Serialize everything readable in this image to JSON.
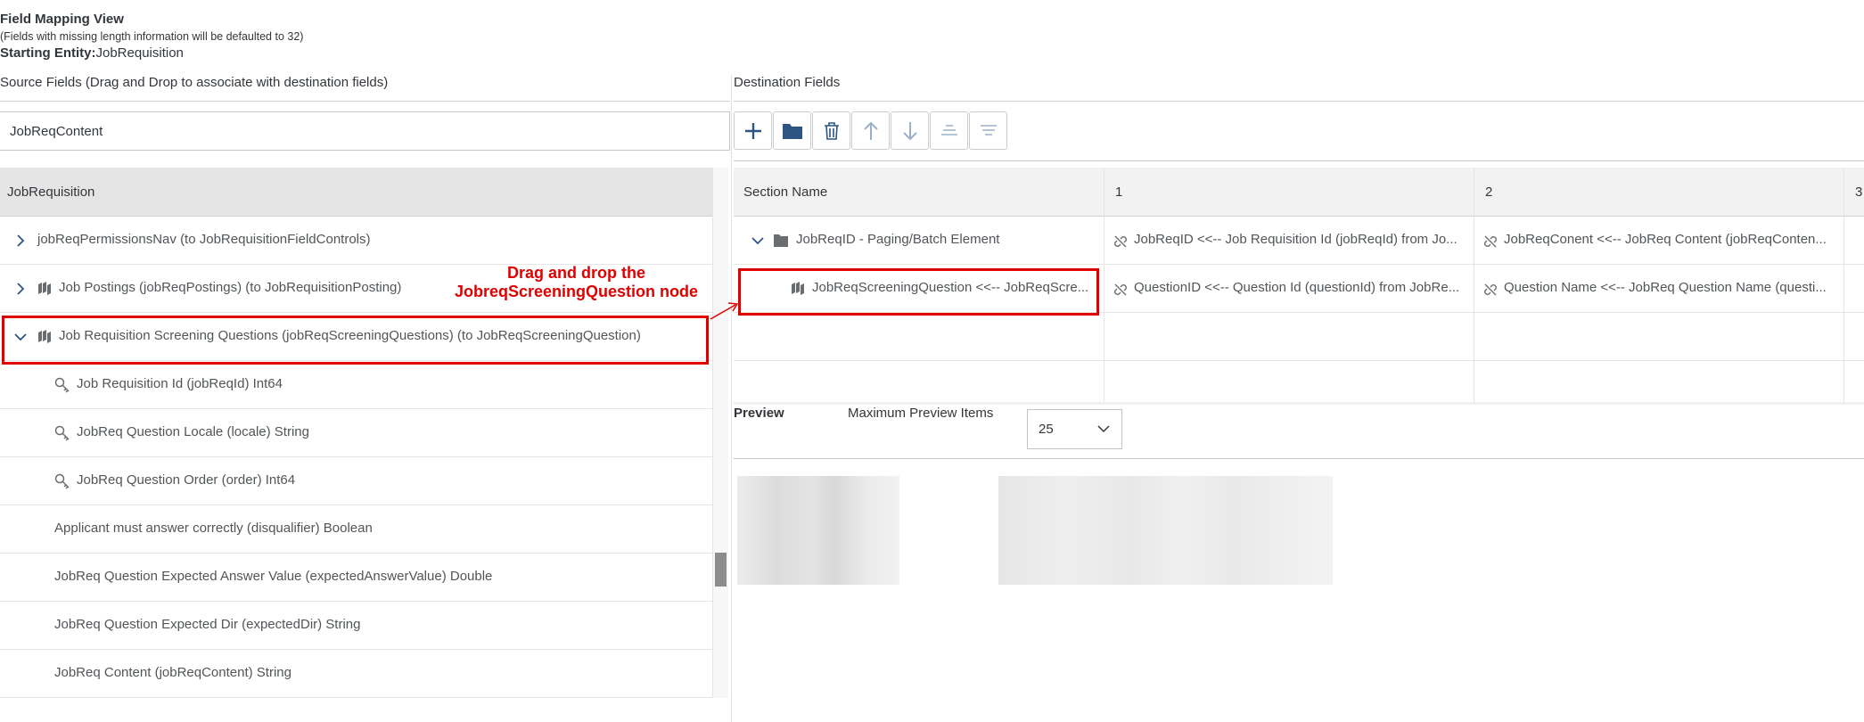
{
  "header": {
    "title": "Field Mapping View",
    "note": "(Fields with missing length information will be defaulted to 32)",
    "starting_entity_label": "Starting Entity:",
    "starting_entity_value": "JobRequisition"
  },
  "source": {
    "title": "Source Fields (Drag and Drop to associate with destination fields)",
    "search_value": "JobReqContent",
    "root_label": "JobRequisition",
    "rows": [
      {
        "label": "jobReqPermissionsNav (to JobRequisitionFieldControls)",
        "icon": "chevron-right-icon"
      },
      {
        "label": "Job Postings (jobReqPostings) (to JobRequisitionPosting)",
        "icon": "entity-icon"
      },
      {
        "label": "Job Requisition Screening Questions (jobReqScreeningQuestions) (to JobReqScreeningQuestion)",
        "icon": "entity-icon"
      },
      {
        "label": "Job Requisition Id (jobReqId) Int64",
        "icon": "key-icon"
      },
      {
        "label": "JobReq Question Locale (locale) String",
        "icon": "key-icon"
      },
      {
        "label": "JobReq Question Order (order) Int64",
        "icon": "key-icon"
      },
      {
        "label": "Applicant must answer correctly (disqualifier) Boolean"
      },
      {
        "label": "JobReq Question Expected Answer Value (expectedAnswerValue) Double"
      },
      {
        "label": "JobReq Question Expected Dir (expectedDir) String"
      },
      {
        "label": "JobReq Content (jobReqContent) String"
      }
    ]
  },
  "destination": {
    "title": "Destination Fields",
    "toolbar": {
      "add": "add-icon",
      "folder": "folder-icon",
      "delete": "delete-icon",
      "up": "arrow-up-icon",
      "down": "arrow-down-icon",
      "collapse": "collapse-icon",
      "expand": "expand-icon"
    },
    "columns": [
      "Section Name",
      "1",
      "2",
      "3"
    ],
    "rows": [
      {
        "section": "JobReqID - Paging/Batch Element",
        "c1": "JobReqID <<-- Job Requisition Id (jobReqId) from Jo...",
        "c2": "JobReqConent <<-- JobReq Content (jobReqConten..."
      },
      {
        "section": "JobReqScreeningQuestion <<-- JobReqScre...",
        "c1": "QuestionID <<-- Question Id (questionId) from JobRe...",
        "c2": "Question Name <<-- JobReq Question Name (questi..."
      }
    ]
  },
  "preview": {
    "label": "Preview",
    "max_items_label": "Maximum Preview Items",
    "max_items_value": "25"
  },
  "annotation": {
    "line1": "Drag and drop the",
    "line2": "JobreqScreeningQuestion node",
    "color": "#e00000"
  }
}
